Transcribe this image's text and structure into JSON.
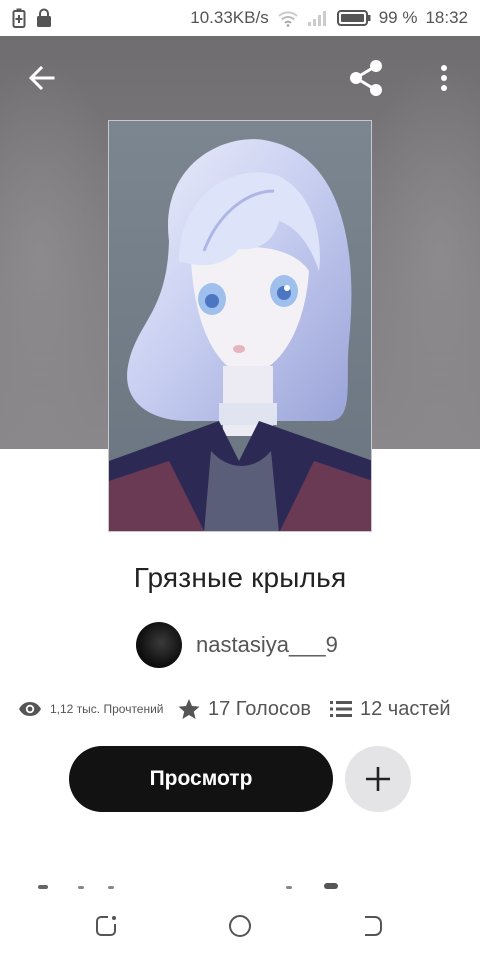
{
  "status_bar": {
    "network_speed": "10.33KB/s",
    "battery": "99 %",
    "time": "18:32"
  },
  "toolbar": {
    "back_icon": "arrow-left-icon",
    "share_icon": "share-icon",
    "more_icon": "more-vertical-icon"
  },
  "story": {
    "title": "Грязные крылья",
    "author": "nastasiya___9",
    "reads": "1,12 тыс. Прочтений",
    "votes": "17 Голосов",
    "parts": "12 частей"
  },
  "actions": {
    "read_label": "Просмотр",
    "add_icon": "plus-icon"
  },
  "colors": {
    "primary_button": "#121212",
    "secondary_button": "#e4e4e6",
    "text": "#222222",
    "muted_text": "#555555"
  }
}
